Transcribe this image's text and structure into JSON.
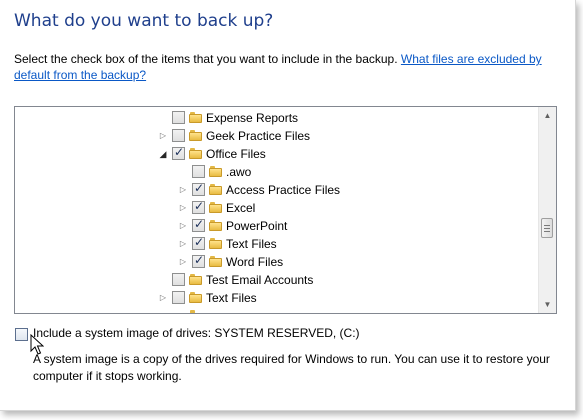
{
  "header": {
    "title": "What do you want to back up?"
  },
  "instructions": {
    "text": "Select the check box of the items that you want to include in the backup. ",
    "link": "What files are excluded by default from the backup?"
  },
  "tree": {
    "items": [
      {
        "label": "Expense Reports",
        "checked": false,
        "expander": "",
        "level": 0
      },
      {
        "label": "Geek Practice Files",
        "checked": false,
        "expander": "collapsed",
        "level": 0
      },
      {
        "label": "Office Files",
        "checked": true,
        "expander": "expanded",
        "level": 0
      },
      {
        "label": ".awo",
        "checked": false,
        "expander": "",
        "level": 1
      },
      {
        "label": "Access Practice Files",
        "checked": true,
        "expander": "collapsed",
        "level": 1
      },
      {
        "label": "Excel",
        "checked": true,
        "expander": "collapsed",
        "level": 1
      },
      {
        "label": "PowerPoint",
        "checked": true,
        "expander": "collapsed",
        "level": 1
      },
      {
        "label": "Text Files",
        "checked": true,
        "expander": "collapsed",
        "level": 1
      },
      {
        "label": "Word Files",
        "checked": true,
        "expander": "collapsed",
        "level": 1
      },
      {
        "label": "Test Email Accounts",
        "checked": false,
        "expander": "",
        "level": 0
      },
      {
        "label": "Text Files",
        "checked": false,
        "expander": "collapsed",
        "level": 0
      }
    ]
  },
  "system_image": {
    "label": "Include a system image of drives: SYSTEM RESERVED, (C:)",
    "checked": false,
    "description": "A system image is a copy of the drives required for Windows to run. You can use it to restore your computer if it stops working."
  }
}
